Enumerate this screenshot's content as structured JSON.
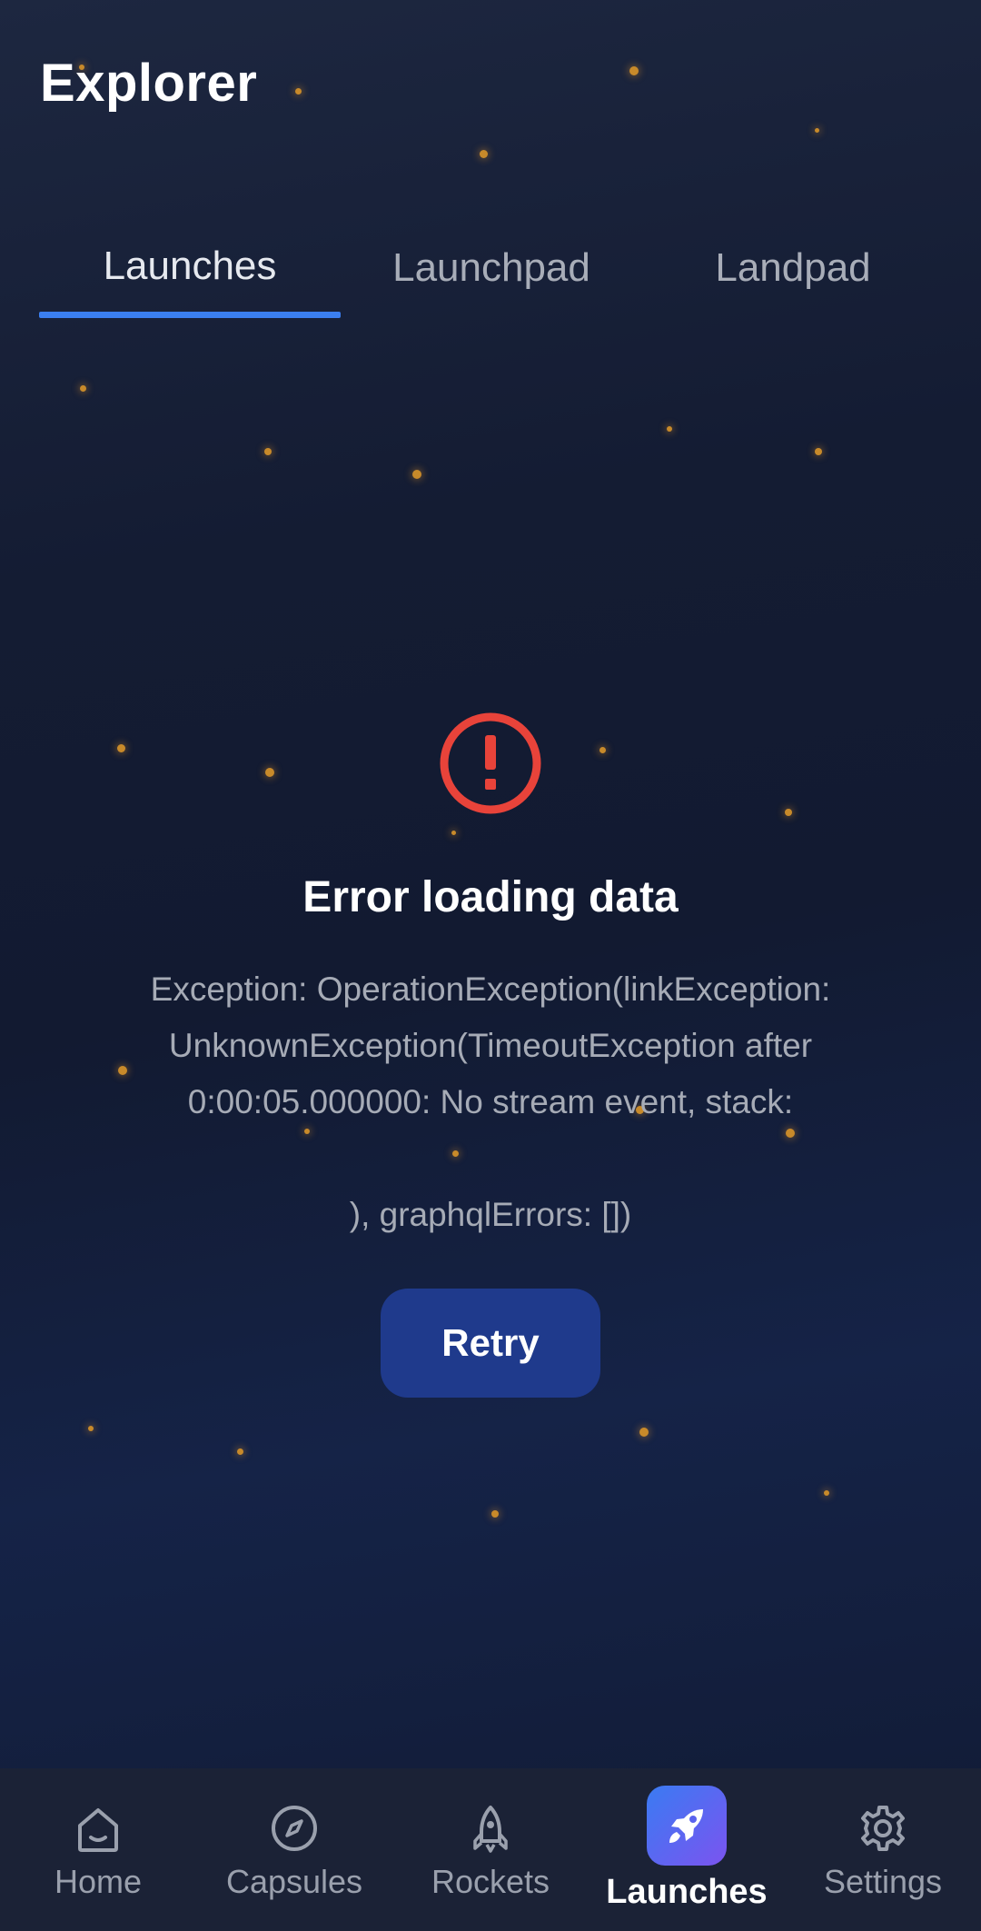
{
  "app": {
    "title": "Explorer"
  },
  "tabs": [
    {
      "label": "Launches",
      "active": true
    },
    {
      "label": "Launchpad",
      "active": false
    },
    {
      "label": "Landpad",
      "active": false
    }
  ],
  "error": {
    "icon": "alert-circle-icon",
    "title": "Error loading data",
    "message": "Exception: OperationException(linkException: UnknownException(TimeoutException after 0:00:05.000000: No stream event, stack:\n\n), graphqlErrors: [])",
    "retry_label": "Retry"
  },
  "bottom_nav": [
    {
      "label": "Home",
      "icon": "home-icon",
      "active": false
    },
    {
      "label": "Capsules",
      "icon": "compass-icon",
      "active": false
    },
    {
      "label": "Rockets",
      "icon": "rocket-outline-icon",
      "active": false
    },
    {
      "label": "Launches",
      "icon": "rocket-launch-icon",
      "active": true
    },
    {
      "label": "Settings",
      "icon": "gear-icon",
      "active": false
    }
  ],
  "colors": {
    "accent": "#3b7ff0",
    "error": "#e8433a",
    "button": "#1f3a8c",
    "star": "#c88a2a"
  }
}
